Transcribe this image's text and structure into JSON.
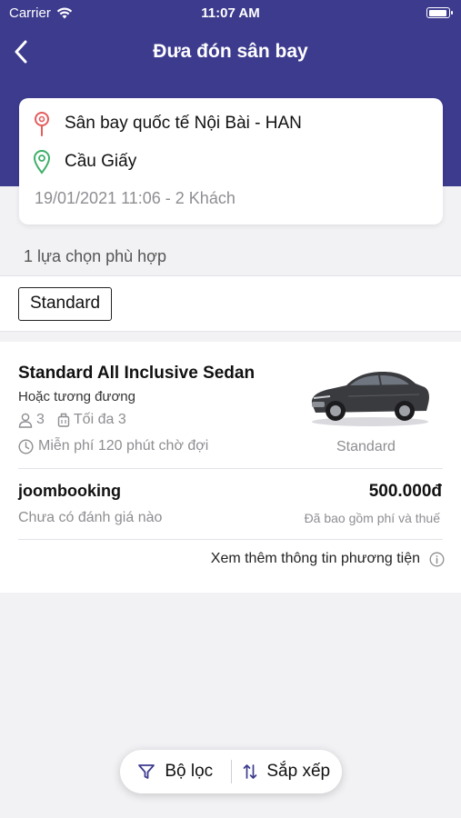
{
  "status_bar": {
    "carrier": "Carrier",
    "time": "11:07 AM"
  },
  "header": {
    "title": "Đưa đón sân bay"
  },
  "route": {
    "from": "Sân bay quốc tế Nội Bài - HAN",
    "to": "Cầu Giấy",
    "meta": "19/01/2021 11:06 - 2 Khách"
  },
  "results": {
    "count_label": "1 lựa chọn phù hợp"
  },
  "filters": {
    "chips": [
      "Standard"
    ]
  },
  "vehicle": {
    "name": "Standard All Inclusive Sedan",
    "subtitle": "Hoặc tương đương",
    "passengers": "3",
    "luggage": "Tối đa 3",
    "wait_time": "Miễn phí 120 phút chờ đợi",
    "class": "Standard",
    "provider": "joombooking",
    "rating": "Chưa có đánh giá nào",
    "price": "500.000đ",
    "price_note": "Đã bao gồm phí và thuế",
    "more_info": "Xem thêm thông tin phương tiện"
  },
  "bottom_bar": {
    "filter_label": "Bộ lọc",
    "sort_label": "Sắp xếp"
  },
  "colors": {
    "header_bg": "#3d3b8e",
    "pin_from": "#e35d5d",
    "pin_to": "#3fae6a",
    "accent": "#3d3b8e"
  }
}
